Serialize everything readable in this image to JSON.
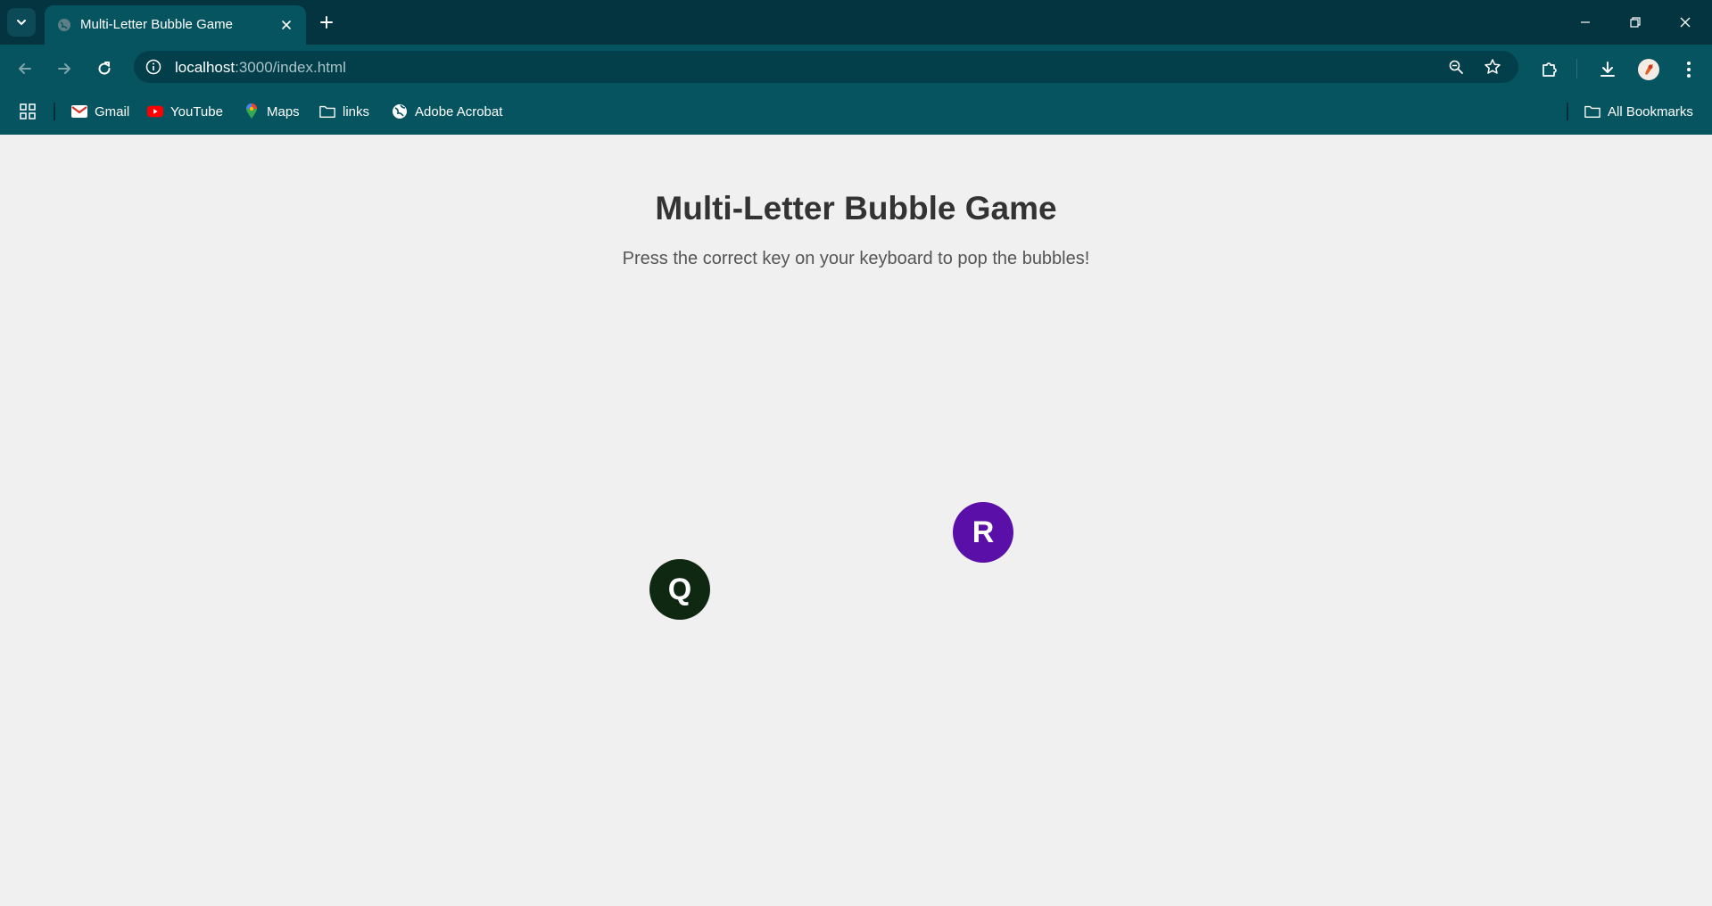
{
  "browser": {
    "tab": {
      "title": "Multi-Letter Bubble Game"
    },
    "address": {
      "host": "localhost",
      "rest": ":3000/index.html"
    },
    "bookmarks": [
      {
        "label": "Gmail",
        "icon": "gmail-icon"
      },
      {
        "label": "YouTube",
        "icon": "youtube-icon"
      },
      {
        "label": "Maps",
        "icon": "maps-icon"
      },
      {
        "label": "links",
        "icon": "folder-icon"
      },
      {
        "label": "Adobe Acrobat",
        "icon": "globe-icon"
      }
    ],
    "all_bookmarks_label": "All Bookmarks",
    "colors": {
      "titlebar": "#033440",
      "toolbar": "#06545f",
      "omnibox": "#033f4a"
    }
  },
  "game": {
    "title": "Multi-Letter Bubble Game",
    "subtitle": "Press the correct key on your keyboard to pop the bubbles!",
    "bubbles": [
      {
        "letter": "Q",
        "color": "#0f2812"
      },
      {
        "letter": "R",
        "color": "#5a0fa8"
      }
    ]
  }
}
